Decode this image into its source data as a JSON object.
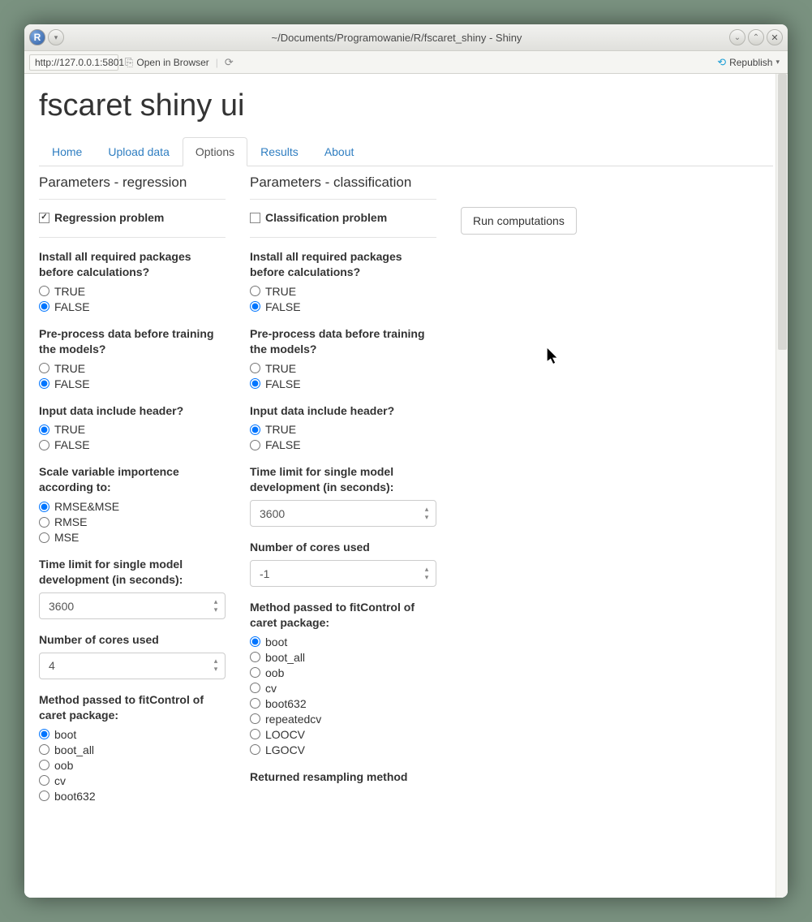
{
  "window": {
    "title": "~/Documents/Programowanie/R/fscaret_shiny - Shiny"
  },
  "toolbar": {
    "url": "http://127.0.0.1:5801",
    "open_browser": "Open in Browser",
    "republish": "Republish"
  },
  "app": {
    "title": "fscaret shiny ui"
  },
  "tabs": {
    "home": "Home",
    "upload": "Upload data",
    "options": "Options",
    "results": "Results",
    "about": "About"
  },
  "regression": {
    "header": "Parameters - regression",
    "checkbox_label": "Regression problem",
    "checkbox_checked": true,
    "q_install": "Install all required packages before calculations?",
    "q_preproc": "Pre-process data before training the models?",
    "q_header": "Input data include header?",
    "q_scale": "Scale variable importence according to:",
    "q_time": "Time limit for single model development (in seconds):",
    "time_value": "3600",
    "q_cores": "Number of cores used",
    "cores_value": "4",
    "q_method": "Method passed to fitControl of caret package:",
    "opt_true": "TRUE",
    "opt_false": "FALSE",
    "scale_opts": {
      "rmsemse": "RMSE&MSE",
      "rmse": "RMSE",
      "mse": "MSE"
    },
    "method_opts": {
      "boot": "boot",
      "boot_all": "boot_all",
      "oob": "oob",
      "cv": "cv",
      "boot632": "boot632"
    }
  },
  "classification": {
    "header": "Parameters - classification",
    "checkbox_label": "Classification problem",
    "checkbox_checked": false,
    "q_install": "Install all required packages before calculations?",
    "q_preproc": "Pre-process data before training the models?",
    "q_header": "Input data include header?",
    "q_time": "Time limit for single model development (in seconds):",
    "time_value": "3600",
    "q_cores": "Number of cores used",
    "cores_value": "-1",
    "q_method": "Method passed to fitControl of caret package:",
    "opt_true": "TRUE",
    "opt_false": "FALSE",
    "method_opts": {
      "boot": "boot",
      "boot_all": "boot_all",
      "oob": "oob",
      "cv": "cv",
      "boot632": "boot632",
      "repeatedcv": "repeatedcv",
      "loocv": "LOOCV",
      "lgocv": "LGOCV"
    },
    "q_return": "Returned resampling method"
  },
  "run_button": "Run computations"
}
